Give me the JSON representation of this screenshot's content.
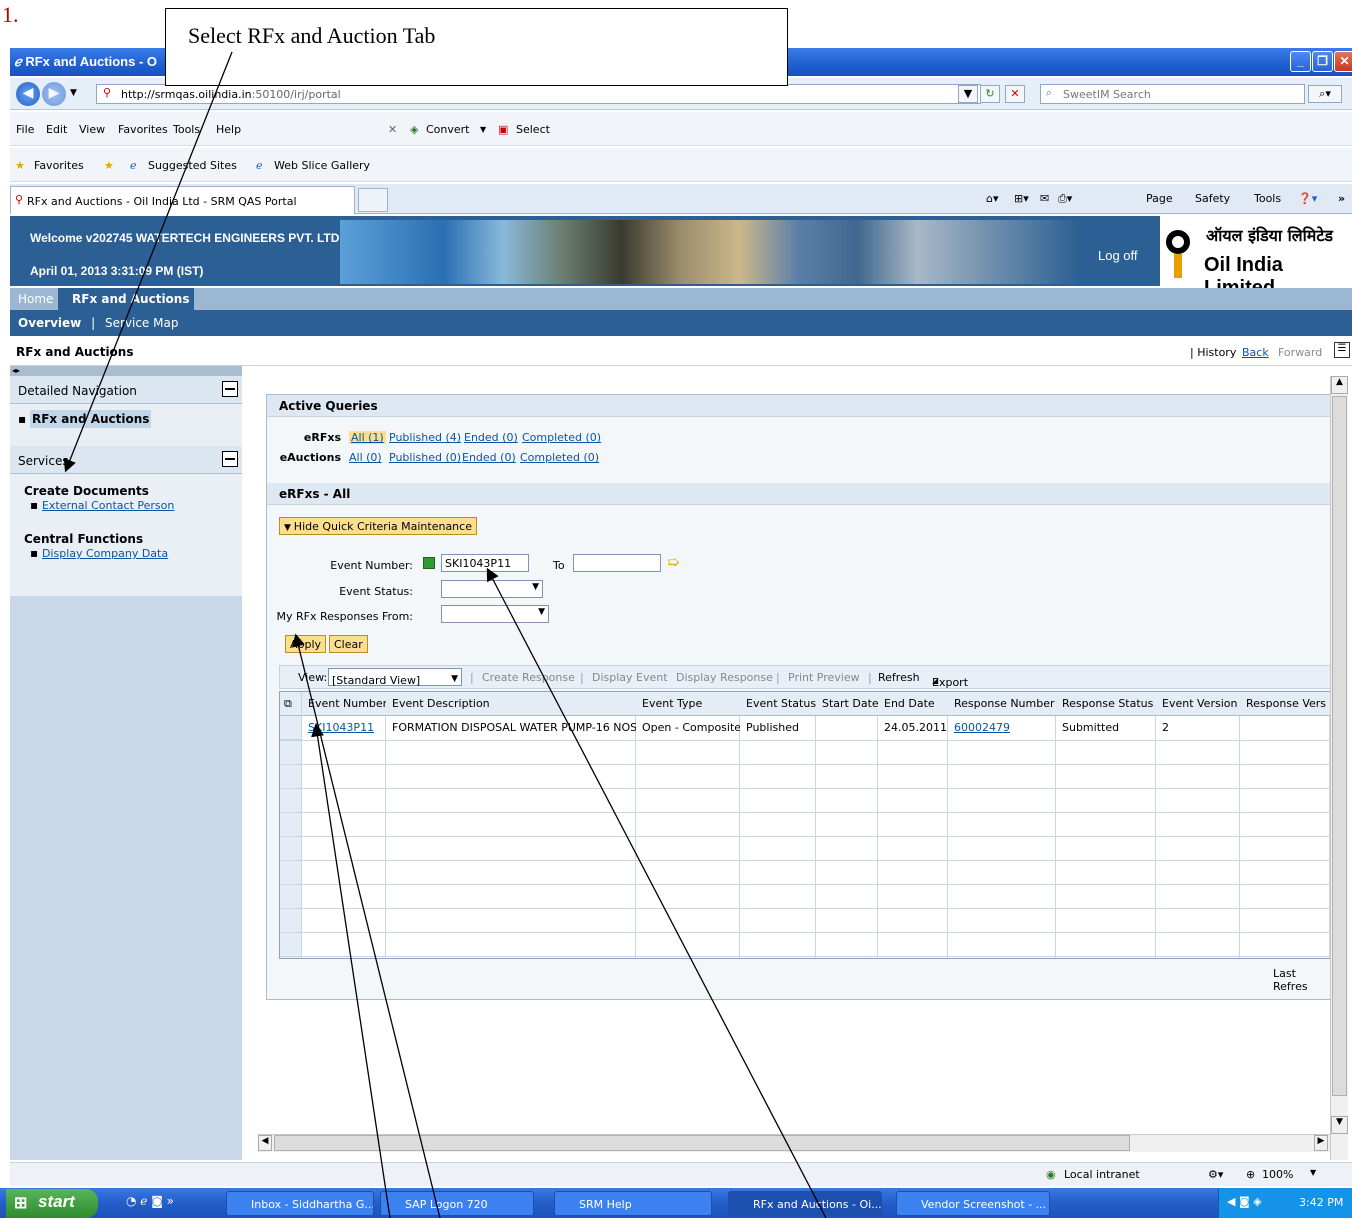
{
  "step_number": "1.",
  "callout_text": "Select RFx and Auction Tab",
  "window": {
    "title": "RFx and Auctions - O",
    "url_host": "http://srmqas.oilindia.in",
    "url_path": ":50100/irj/portal",
    "search_placeholder": "SweetIM Search"
  },
  "menu": {
    "file": "File",
    "edit": "Edit",
    "view": "View",
    "favorites": "Favorites",
    "tools": "Tools",
    "help": "Help",
    "convert": "Convert",
    "select": "Select"
  },
  "favbar": {
    "favorites": "Favorites",
    "suggested": "Suggested Sites",
    "webslice": "Web Slice Gallery"
  },
  "tab": {
    "title": "RFx and Auctions - Oil India Ltd - SRM QAS Portal"
  },
  "cmdbar": {
    "page": "Page",
    "safety": "Safety",
    "tools": "Tools"
  },
  "header": {
    "welcome": "Welcome v202745 WATERTECH ENGINEERS PVT. LTD.",
    "date": "April 01, 2013  3:31:09 PM (IST)",
    "logoff": "Log off",
    "logo_hindi": "ऑयल इंडिया लिमिटेड",
    "logo_english": "Oil India Limited"
  },
  "nav": {
    "home": "Home",
    "rfx": "RFx and Auctions",
    "overview": "Overview",
    "sep": "|",
    "servicemap": "Service Map"
  },
  "crumb": {
    "title": "RFx and Auctions",
    "history": "| History",
    "back": "Back",
    "forward": "Forward"
  },
  "left": {
    "detailed_nav": "Detailed Navigation",
    "rfx_item": "RFx and Auctions",
    "services": "Services",
    "create_docs": "Create Documents",
    "ext_contact": "External Contact Person",
    "central": "Central Functions",
    "display_company": "Display Company Data"
  },
  "queries": {
    "header": "Active Queries",
    "erfxs_label": "eRFxs",
    "eauctions_label": "eAuctions",
    "erfx_links": [
      "All (1)",
      "Published (4)",
      "Ended (0)",
      "Completed (0)"
    ],
    "eauction_links": [
      "All (0)",
      "Published (0)",
      "Ended (0)",
      "Completed (0)"
    ]
  },
  "erfx_panel": {
    "header": "eRFxs - All",
    "hide_criteria": "Hide Quick Criteria Maintenance",
    "event_number_label": "Event Number:",
    "event_number_value": "SKI1043P11",
    "to_label": "To",
    "event_status_label": "Event Status:",
    "responses_from_label": "My RFx Responses From:",
    "apply": "Apply",
    "clear": "Clear"
  },
  "toolbar": {
    "view_label": "View:",
    "view_value": "[Standard View]",
    "create_response": "Create Response",
    "display_event": "Display Event",
    "display_response": "Display Response",
    "print_preview": "Print Preview",
    "refresh": "Refresh",
    "export": "Export"
  },
  "table": {
    "headers": [
      "Event Number",
      "Event Description",
      "Event Type",
      "Event Status",
      "Start Date",
      "End Date",
      "Response Number",
      "Response Status",
      "Event Version",
      "Response Vers"
    ],
    "row": [
      "SKI1043P11",
      "FORMATION DISPOSAL WATER PUMP-16 NOS",
      "Open - Composite",
      "Published",
      "",
      "24.05.2011",
      "60002479",
      "Submitted",
      "2",
      ""
    ],
    "last_refresh": "Last Refres"
  },
  "status": {
    "zone": "Local intranet",
    "zoom": "100%"
  },
  "taskbar": {
    "start": "start",
    "items": [
      "Inbox - Siddhartha G...",
      "SAP Logon 720",
      "SRM Help",
      "RFx and Auctions - Oi...",
      "Vendor Screenshot - ..."
    ],
    "time": "3:42 PM"
  },
  "colors": {
    "portal_blue": "#2c5f93",
    "highlight_yellow": "#fcdf8c",
    "link": "#0a55a3",
    "xp_titlebar": "#1f5fd0"
  }
}
